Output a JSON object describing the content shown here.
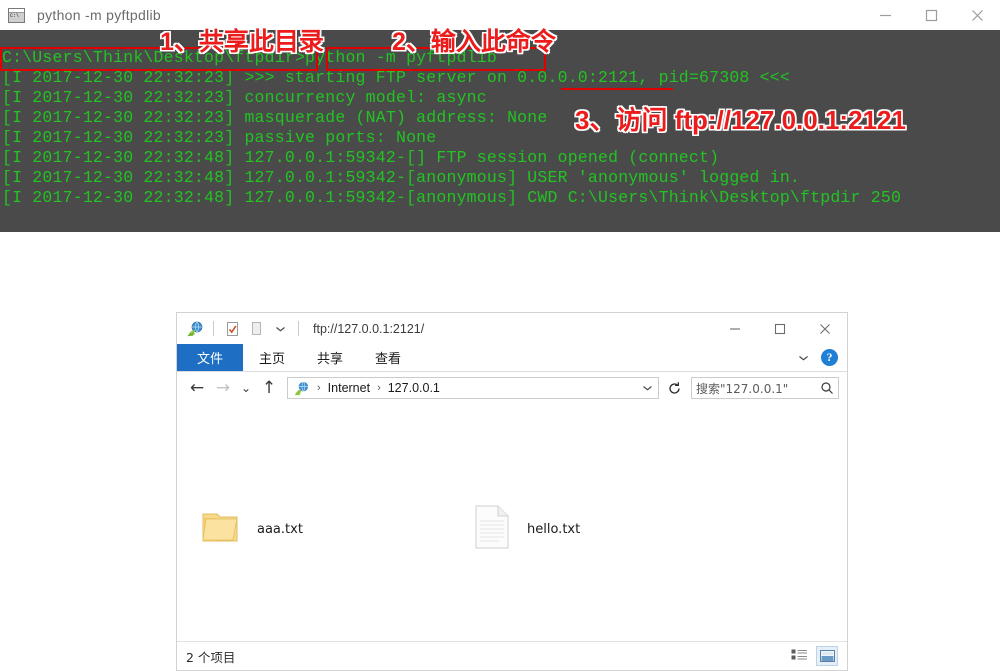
{
  "cmd": {
    "icon": "cmd-console-icon",
    "title": "python  -m pyftpdlib",
    "window_controls": [
      {
        "name": "minimize-button",
        "glyph": "minimize-icon"
      },
      {
        "name": "maximize-button",
        "glyph": "maximize-icon"
      },
      {
        "name": "close-button",
        "glyph": "close-icon"
      }
    ],
    "console_lines": [
      "C:\\Users\\Think\\Desktop\\ftpdir>python -m pyftpdlib",
      "[I 2017-12-30 22:32:23] >>> starting FTP server on 0.0.0.0:2121, pid=67308 <<<",
      "[I 2017-12-30 22:32:23] concurrency model: async",
      "[I 2017-12-30 22:32:23] masquerade (NAT) address: None",
      "[I 2017-12-30 22:32:23] passive ports: None",
      "[I 2017-12-30 22:32:48] 127.0.0.1:59342-[] FTP session opened (connect)",
      "[I 2017-12-30 22:32:48] 127.0.0.1:59342-[anonymous] USER 'anonymous' logged in.",
      "[I 2017-12-30 22:32:48] 127.0.0.1:59342-[anonymous] CWD C:\\Users\\Think\\Desktop\\ftpdir 250"
    ]
  },
  "annotations": {
    "color": "#ec1c1c",
    "step1": "1、共享此目录",
    "step2": "2、输入此命令",
    "step3": "3、访问 ftp://127.0.0.1:2121"
  },
  "explorer": {
    "titlebar": {
      "address_title": "ftp://127.0.0.1:2121/",
      "quick_access": [
        {
          "name": "ftp-site-icon",
          "label": "internet-globe-icon"
        },
        {
          "name": "properties-icon",
          "label": "properties-icon"
        },
        {
          "name": "new-folder-icon",
          "label": "new-folder-icon"
        },
        {
          "name": "customize-qat-dropdown",
          "label": "chevron-down-icon"
        }
      ],
      "window_controls": [
        {
          "name": "minimize-button",
          "glyph": "minimize-icon"
        },
        {
          "name": "maximize-button",
          "glyph": "maximize-icon"
        },
        {
          "name": "close-button",
          "glyph": "close-icon"
        }
      ]
    },
    "ribbon": {
      "tabs": [
        {
          "label": "文件",
          "selected": true
        },
        {
          "label": "主页",
          "selected": false
        },
        {
          "label": "共享",
          "selected": false
        },
        {
          "label": "查看",
          "selected": false
        }
      ],
      "expand_label": "chevron-down-icon",
      "help_label": "?"
    },
    "nav": {
      "back": "back-arrow-icon",
      "forward": "forward-arrow-icon",
      "recent": "recent-locations-icon",
      "up": "up-arrow-icon",
      "breadcrumb": [
        "Internet",
        "127.0.0.1"
      ],
      "breadcrumb_separator": "›",
      "address_dropdown": "chevron-down-icon",
      "refresh": "refresh-icon"
    },
    "search": {
      "value": "搜索\"127.0.0.1\"",
      "placeholder": "搜索\"127.0.0.1\"",
      "icon": "search-icon"
    },
    "files": [
      {
        "name": "aaa.txt",
        "icon": "folder-icon"
      },
      {
        "name": "hello.txt",
        "icon": "text-document-icon"
      }
    ],
    "statusbar": {
      "count": "2 个项目",
      "views": [
        {
          "name": "details-view-button",
          "icon": "details-view-icon",
          "active": false
        },
        {
          "name": "large-icons-view-button",
          "icon": "large-icons-view-icon",
          "active": true
        }
      ]
    }
  },
  "colors": {
    "console_bg": "#4a4a4a",
    "console_fg": "#22c322",
    "accent": "#1e6fc4",
    "annotation_red": "#ec1c1c",
    "folder_yellow": "#f5cf6b"
  }
}
